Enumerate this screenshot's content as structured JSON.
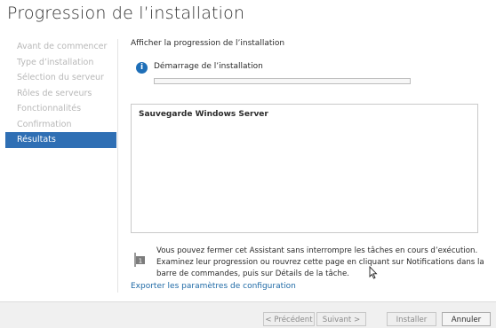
{
  "window": {
    "title": "Progression de l’installation"
  },
  "sidebar": {
    "items": [
      {
        "label": "Avant de commencer"
      },
      {
        "label": "Type d’installation"
      },
      {
        "label": "Sélection du serveur"
      },
      {
        "label": "Rôles de serveurs"
      },
      {
        "label": "Fonctionnalités"
      },
      {
        "label": "Confirmation"
      },
      {
        "label": "Résultats",
        "active": true
      }
    ]
  },
  "main": {
    "section_label": "Afficher la progression de l’installation",
    "status": {
      "icon": "info-icon",
      "text": "Démarrage de l’installation",
      "progress": 0
    },
    "results": {
      "items": [
        "Sauvegarde Windows Server"
      ]
    },
    "note": {
      "icon": "notification-flag-icon",
      "text": "Vous pouvez fermer cet Assistant sans interrompre les tâches en cours d’exécution. Examinez leur progression ou rouvrez cette page en cliquant sur Notifications dans la barre de commandes, puis sur Détails de la tâche."
    },
    "export_link": "Exporter les paramètres de configuration"
  },
  "footer": {
    "previous_label": "< Précédent",
    "next_label": "Suivant >",
    "install_label": "Installer",
    "cancel_label": "Annuler"
  },
  "colors": {
    "accent": "#2f6fb4",
    "link": "#1f6aa6",
    "disabled_text": "#b8b8b8"
  }
}
